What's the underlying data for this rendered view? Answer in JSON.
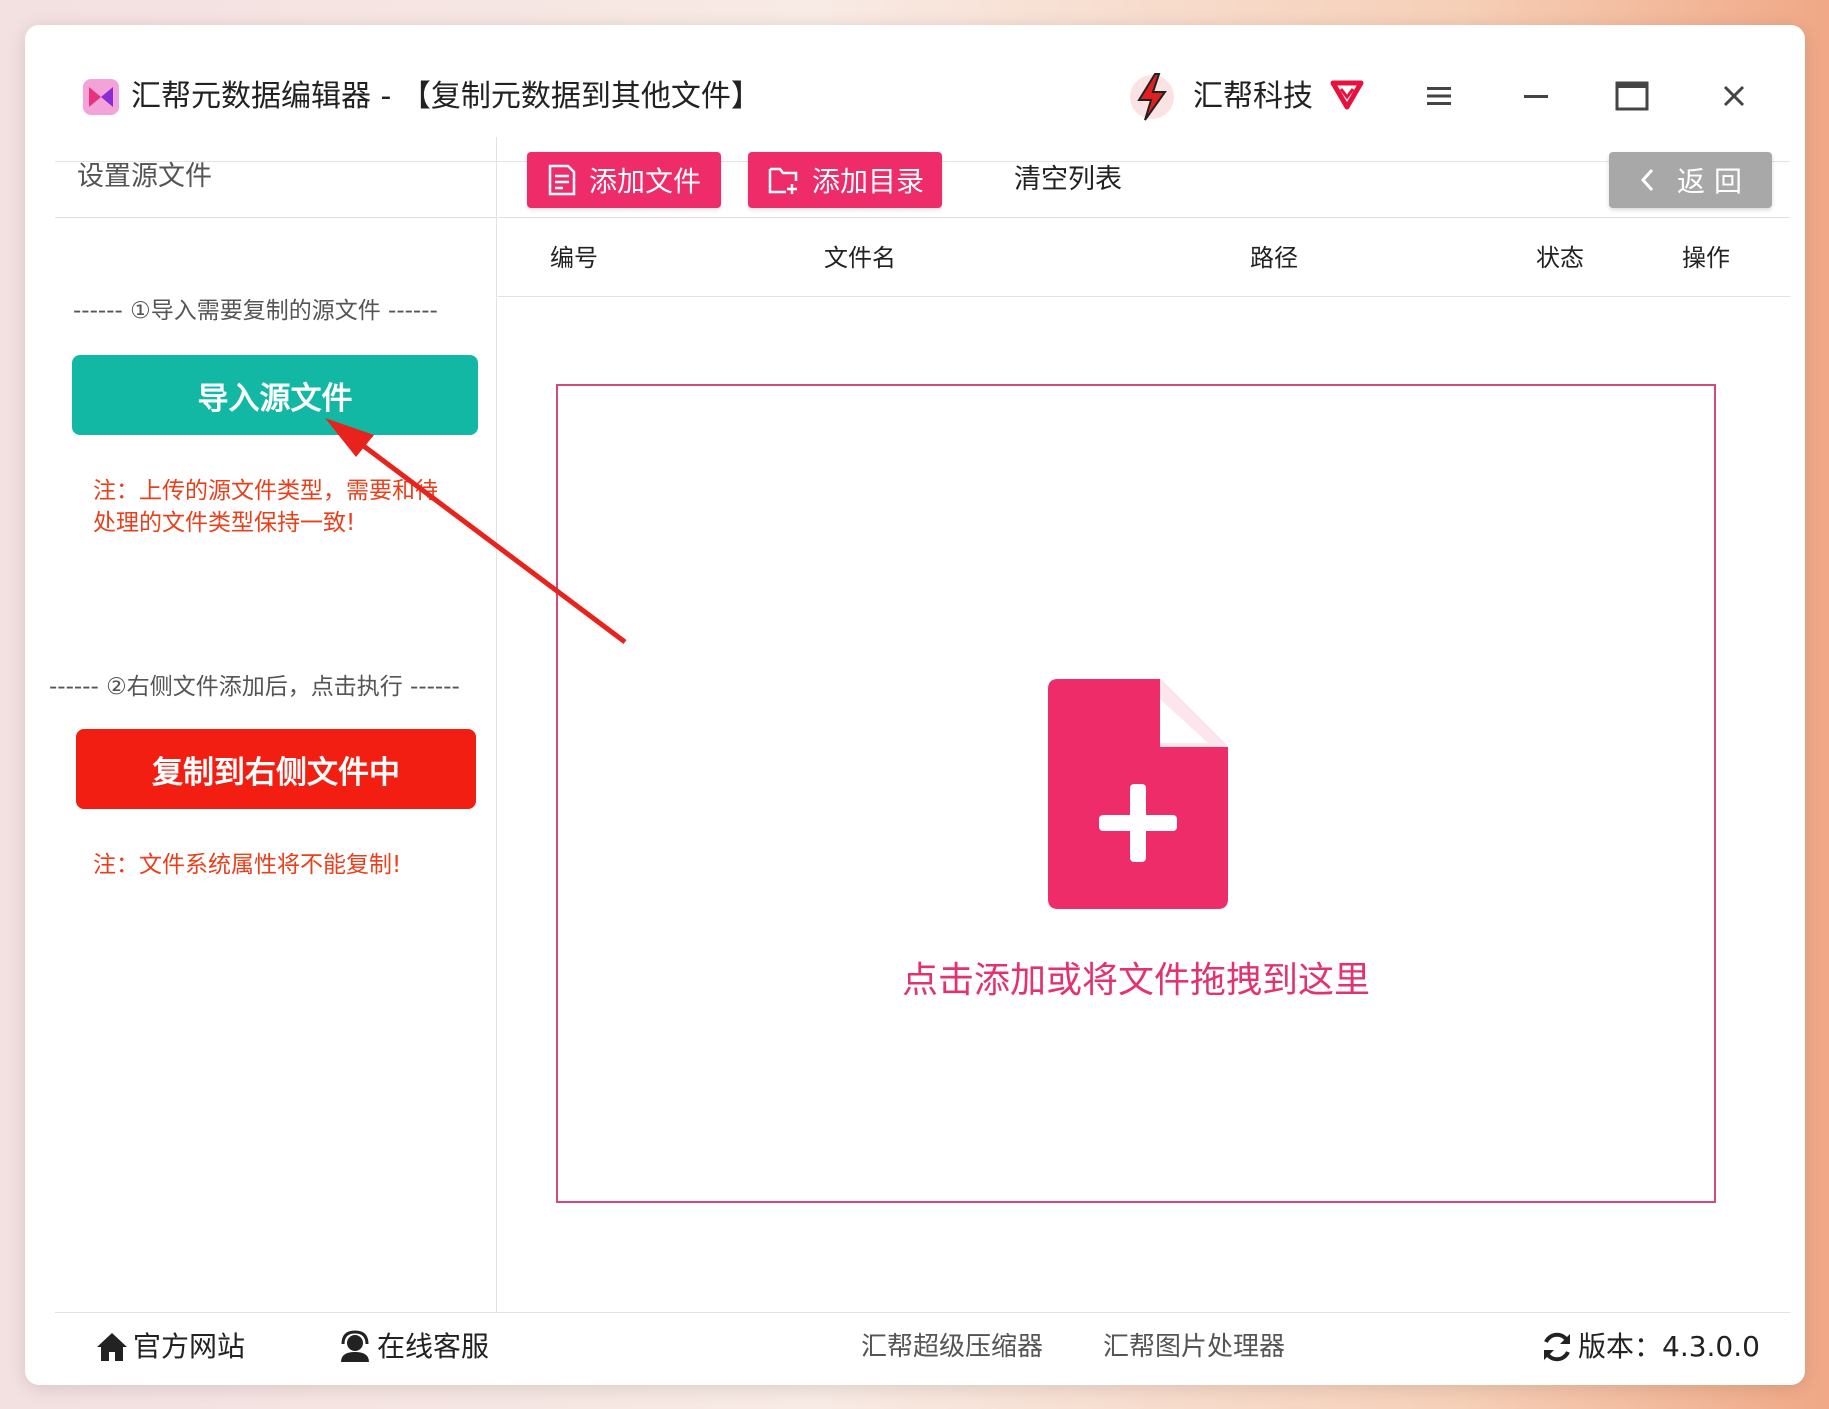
{
  "titlebar": {
    "app_title": "汇帮元数据编辑器 - 【复制元数据到其他文件】",
    "brand_name": "汇帮科技"
  },
  "left_panel": {
    "header": "设置源文件",
    "step1": "------ ①导入需要复制的源文件 ------",
    "import_button": "导入源文件",
    "note1_line1": "注：上传的源文件类型，需要和待",
    "note1_line2": "处理的文件类型保持一致!",
    "step2": "------ ②右侧文件添加后，点击执行 ------",
    "copy_button": "复制到右侧文件中",
    "note2": "注：文件系统属性将不能复制!"
  },
  "toolbar": {
    "add_file": "添加文件",
    "add_dir": "添加目录",
    "clear_list": "清空列表",
    "back": "返 回"
  },
  "table": {
    "columns": [
      "编号",
      "文件名",
      "路径",
      "状态",
      "操作"
    ]
  },
  "drop_zone": {
    "text": "点击添加或将文件拖拽到这里"
  },
  "footer": {
    "website": "官方网站",
    "support": "在线客服",
    "compressor": "汇帮超级压缩器",
    "image_tool": "汇帮图片处理器",
    "version": "版本：4.3.0.0"
  },
  "colors": {
    "accent_pink": "#ef2c6a",
    "teal": "#12b8a3",
    "red": "#f21e12",
    "note_orange": "#e8401c"
  }
}
